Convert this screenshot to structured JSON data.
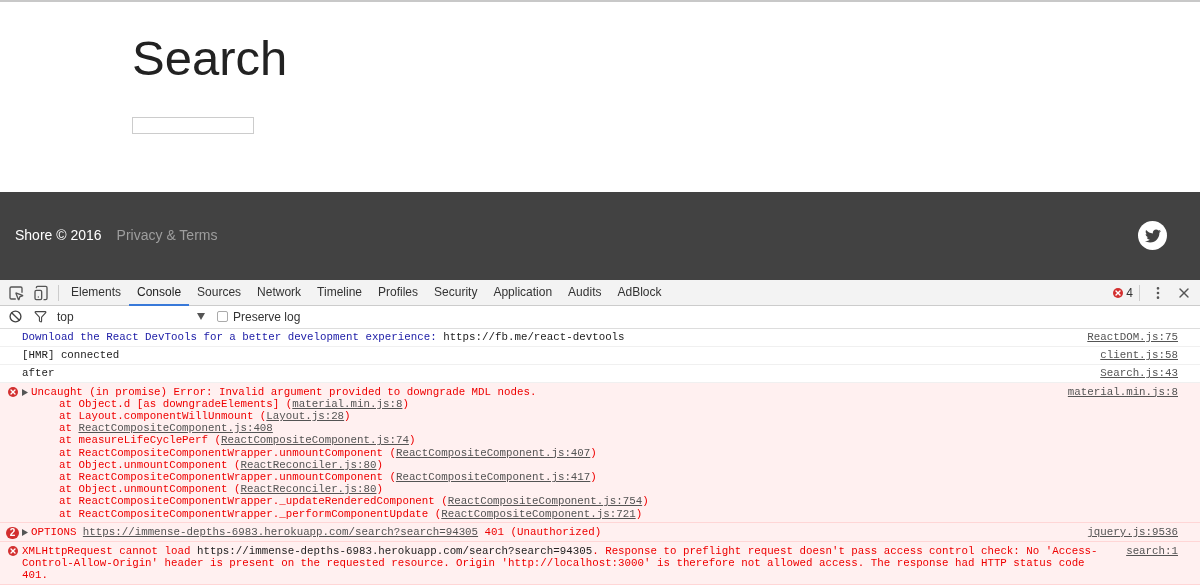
{
  "page": {
    "title": "Search"
  },
  "footer": {
    "copyright": "Shore © 2016",
    "link": "Privacy & Terms"
  },
  "devtools": {
    "tabs": [
      {
        "label": "Elements",
        "selected": false
      },
      {
        "label": "Console",
        "selected": true
      },
      {
        "label": "Sources",
        "selected": false
      },
      {
        "label": "Network",
        "selected": false
      },
      {
        "label": "Timeline",
        "selected": false
      },
      {
        "label": "Profiles",
        "selected": false
      },
      {
        "label": "Security",
        "selected": false
      },
      {
        "label": "Application",
        "selected": false
      },
      {
        "label": "Audits",
        "selected": false
      },
      {
        "label": "AdBlock",
        "selected": false
      }
    ],
    "error_count": "4",
    "context": "top",
    "preserve_log": {
      "label": "Preserve log",
      "checked": false
    },
    "messages": [
      {
        "kind": "info",
        "parts": [
          {
            "kind": "plain",
            "text": "Download the React DevTools for a better development experience: "
          },
          {
            "kind": "url",
            "text": "https://fb.me/react-devtools"
          }
        ],
        "source": "ReactDOM.js:75"
      },
      {
        "kind": "log",
        "parts": [
          {
            "kind": "plain",
            "text": "[HMR] connected"
          }
        ],
        "source": "client.js:58"
      },
      {
        "kind": "log",
        "parts": [
          {
            "kind": "plain",
            "text": "after"
          }
        ],
        "source": "Search.js:43"
      },
      {
        "kind": "error",
        "has_toggle": true,
        "parts": [
          {
            "kind": "plain",
            "text": "Uncaught (in promise) Error: Invalid argument provided to downgrade MDL nodes."
          }
        ],
        "source": "material.min.js:8",
        "stack": [
          [
            {
              "kind": "plain",
              "text": "at Object.d [as downgradeElements] ("
            },
            {
              "kind": "link",
              "text": "material.min.js:8"
            },
            {
              "kind": "plain",
              "text": ")"
            }
          ],
          [
            {
              "kind": "plain",
              "text": "at Layout.componentWillUnmount ("
            },
            {
              "kind": "link",
              "text": "Layout.js:28"
            },
            {
              "kind": "plain",
              "text": ")"
            }
          ],
          [
            {
              "kind": "plain",
              "text": "at "
            },
            {
              "kind": "link",
              "text": "ReactCompositeComponent.js:408"
            }
          ],
          [
            {
              "kind": "plain",
              "text": "at measureLifeCyclePerf ("
            },
            {
              "kind": "link",
              "text": "ReactCompositeComponent.js:74"
            },
            {
              "kind": "plain",
              "text": ")"
            }
          ],
          [
            {
              "kind": "plain",
              "text": "at ReactCompositeComponentWrapper.unmountComponent ("
            },
            {
              "kind": "link",
              "text": "ReactCompositeComponent.js:407"
            },
            {
              "kind": "plain",
              "text": ")"
            }
          ],
          [
            {
              "kind": "plain",
              "text": "at Object.unmountComponent ("
            },
            {
              "kind": "link",
              "text": "ReactReconciler.js:80"
            },
            {
              "kind": "plain",
              "text": ")"
            }
          ],
          [
            {
              "kind": "plain",
              "text": "at ReactCompositeComponentWrapper.unmountComponent ("
            },
            {
              "kind": "link",
              "text": "ReactCompositeComponent.js:417"
            },
            {
              "kind": "plain",
              "text": ")"
            }
          ],
          [
            {
              "kind": "plain",
              "text": "at Object.unmountComponent ("
            },
            {
              "kind": "link",
              "text": "ReactReconciler.js:80"
            },
            {
              "kind": "plain",
              "text": ")"
            }
          ],
          [
            {
              "kind": "plain",
              "text": "at ReactCompositeComponentWrapper._updateRenderedComponent ("
            },
            {
              "kind": "link",
              "text": "ReactCompositeComponent.js:754"
            },
            {
              "kind": "plain",
              "text": ")"
            }
          ],
          [
            {
              "kind": "plain",
              "text": "at ReactCompositeComponentWrapper._performComponentUpdate ("
            },
            {
              "kind": "link",
              "text": "ReactCompositeComponent.js:721"
            },
            {
              "kind": "plain",
              "text": ")"
            }
          ]
        ]
      },
      {
        "kind": "error",
        "count": "2",
        "has_toggle": true,
        "parts": [
          {
            "kind": "plain",
            "text": "OPTIONS "
          },
          {
            "kind": "link",
            "text": "https://immense-depths-6983.herokuapp.com/search?search=94305"
          },
          {
            "kind": "plain",
            "text": " 401 (Unauthorized)"
          }
        ],
        "source": "jquery.js:9536"
      },
      {
        "kind": "error",
        "parts": [
          {
            "kind": "plain",
            "text": "XMLHttpRequest cannot load "
          },
          {
            "kind": "url",
            "text": "https://immense-depths-6983.herokuapp.com/search?search=94305"
          },
          {
            "kind": "plain",
            "text": ". Response to preflight request doesn't pass access control check: No 'Access-Control-Allow-Origin' header is present on the requested resource. Origin 'http://localhost:3000' is therefore not allowed access. The response had HTTP status code 401."
          }
        ],
        "source": "search:1"
      }
    ]
  }
}
